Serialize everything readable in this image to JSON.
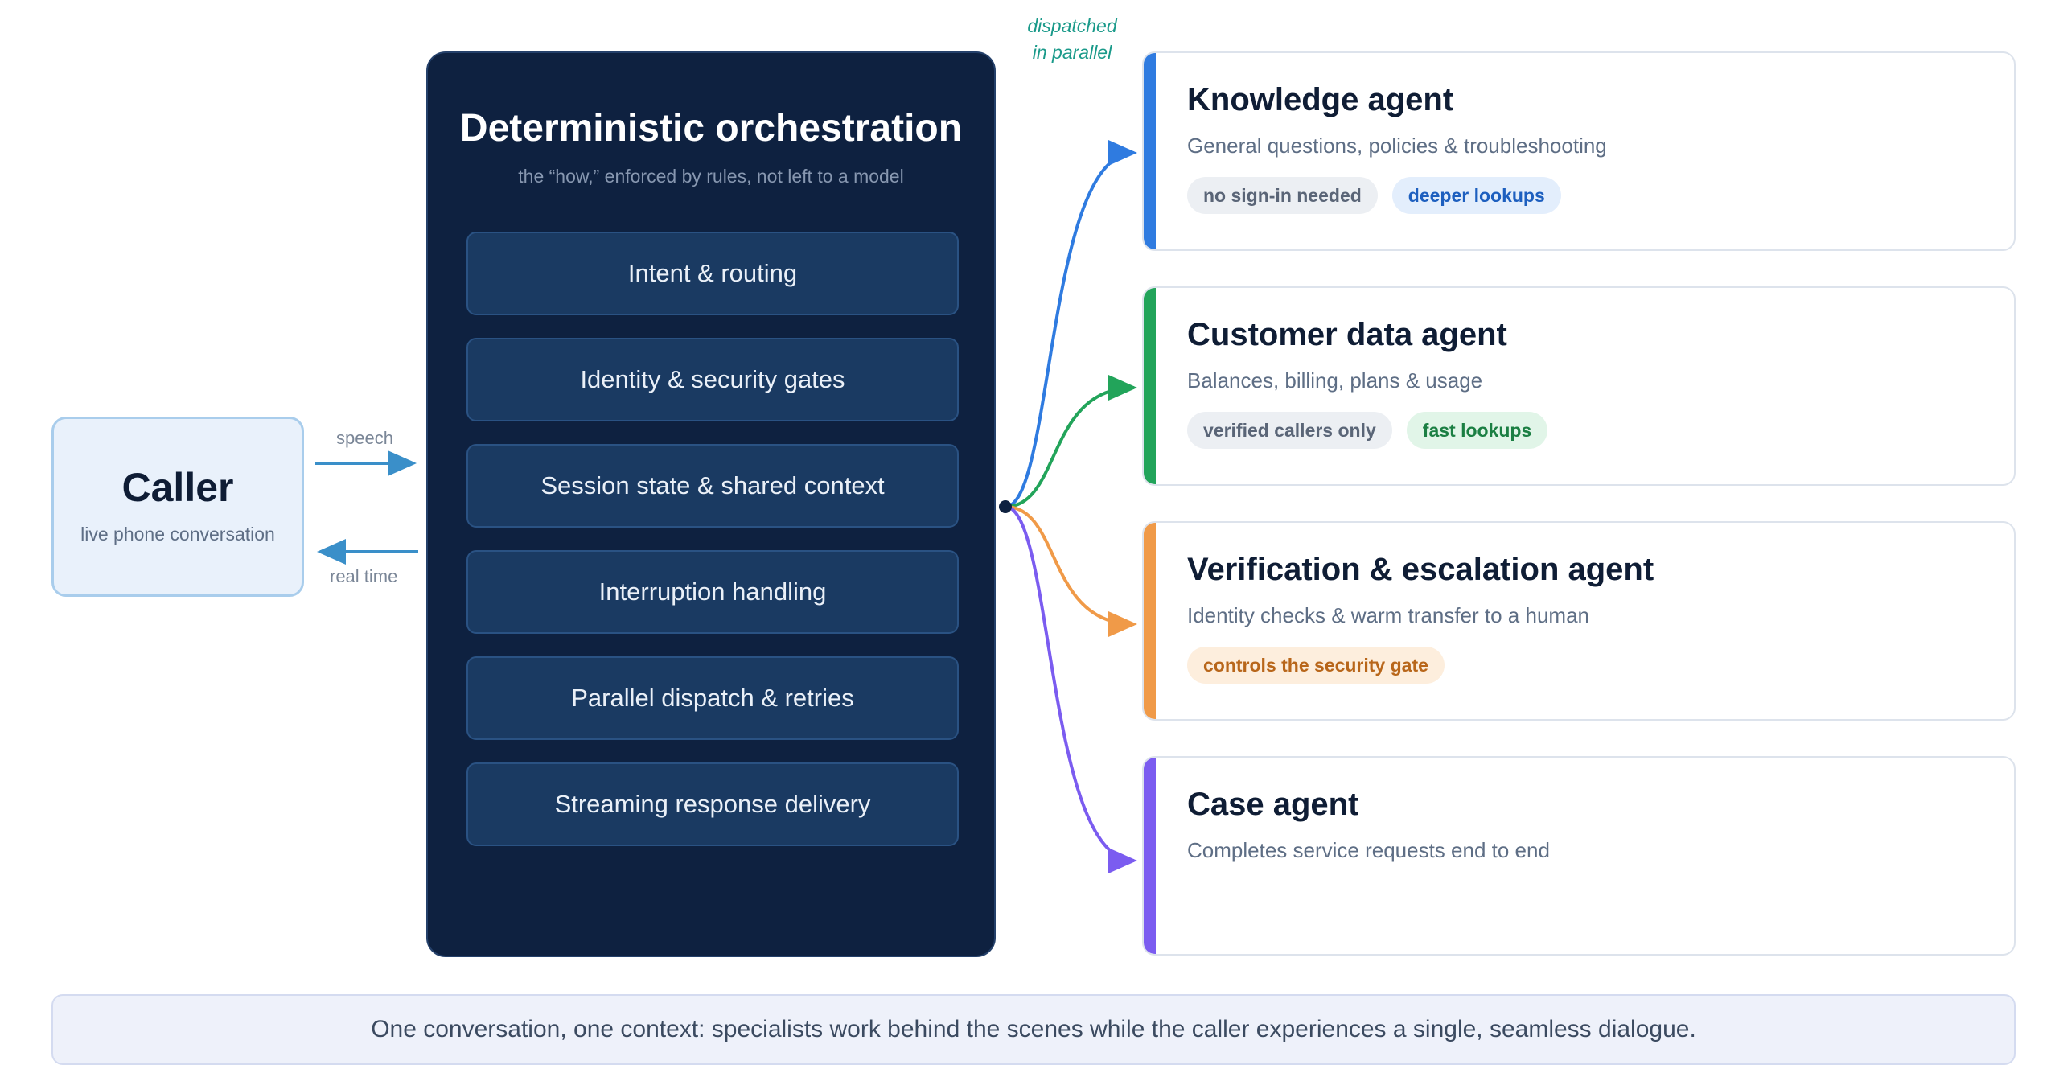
{
  "caller": {
    "title": "Caller",
    "subtitle": "live phone conversation",
    "speech_label": "speech",
    "realtime_label": "real time"
  },
  "orchestration": {
    "title": "Deterministic orchestration",
    "subtitle": "the “how,” enforced by rules, not left to a model",
    "steps": [
      "Intent & routing",
      "Identity & security gates",
      "Session state & shared context",
      "Interruption handling",
      "Parallel dispatch & retries",
      "Streaming response delivery"
    ]
  },
  "dispatch": {
    "line1": "dispatched",
    "line2": "in parallel"
  },
  "agents": [
    {
      "title": "Knowledge agent",
      "description": "General questions, policies & troubleshooting",
      "color": "#2f7be0",
      "tags": [
        {
          "label": "no sign-in needed",
          "bg": "#eceff3",
          "fg": "#5a6577"
        },
        {
          "label": "deeper lookups",
          "bg": "#e3eefc",
          "fg": "#1d5fbf"
        }
      ]
    },
    {
      "title": "Customer data agent",
      "description": "Balances, billing, plans & usage",
      "color": "#22a45a",
      "tags": [
        {
          "label": "verified callers only",
          "bg": "#eceff3",
          "fg": "#5a6577"
        },
        {
          "label": "fast lookups",
          "bg": "#e1f5e8",
          "fg": "#1b7f43"
        }
      ]
    },
    {
      "title": "Verification & escalation agent",
      "description": "Identity checks & warm transfer to a human",
      "color": "#f09a48",
      "tags": [
        {
          "label": "controls the security gate",
          "bg": "#fdeedd",
          "fg": "#b8661a"
        }
      ]
    },
    {
      "title": "Case agent",
      "description": "Completes service requests end to end",
      "color": "#7b5cf0",
      "tags": []
    }
  ],
  "colors": {
    "flow_arrow": "#3a8fc9",
    "panel": "#0e2140",
    "node": "#0e2140"
  },
  "footer": {
    "text": "One conversation, one context: specialists work behind the scenes while the caller experiences a single, seamless dialogue."
  }
}
